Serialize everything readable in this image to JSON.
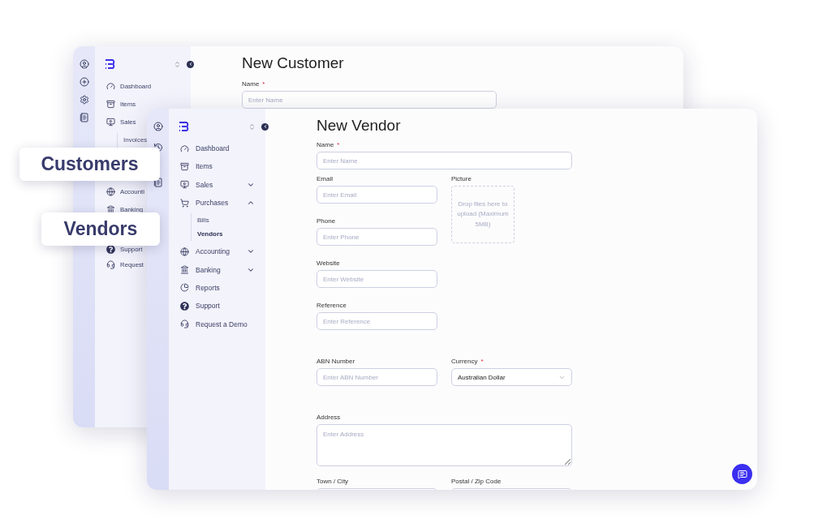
{
  "back_window": {
    "title": "New Customer",
    "nav": [
      {
        "label": "Dashboard"
      },
      {
        "label": "Items"
      },
      {
        "label": "Sales",
        "children": [
          {
            "label": "Invoices",
            "selected": false
          }
        ]
      },
      {
        "label": "Accounti"
      },
      {
        "label": "Banking"
      },
      {
        "label": "Support"
      },
      {
        "label": "Request"
      }
    ],
    "name_field": {
      "label": "Name",
      "required_mark": "*",
      "placeholder": "Enter Name"
    }
  },
  "front_window": {
    "title": "New Vendor",
    "nav": [
      {
        "label": "Dashboard"
      },
      {
        "label": "Items"
      },
      {
        "label": "Sales",
        "expanded": false
      },
      {
        "label": "Purchases",
        "expanded": true,
        "children": [
          {
            "label": "Bills",
            "selected": false
          },
          {
            "label": "Vendors",
            "selected": true
          }
        ]
      },
      {
        "label": "Accounting",
        "expanded": false
      },
      {
        "label": "Banking",
        "expanded": false
      },
      {
        "label": "Reports"
      },
      {
        "label": "Support"
      },
      {
        "label": "Request a Demo"
      }
    ],
    "name_field": {
      "label": "Name",
      "required_mark": "*",
      "placeholder": "Enter Name"
    },
    "contact_fields": [
      {
        "label": "Email",
        "placeholder": "Enter Email"
      },
      {
        "label": "Phone",
        "placeholder": "Enter Phone"
      },
      {
        "label": "Website",
        "placeholder": "Enter Website"
      },
      {
        "label": "Reference",
        "placeholder": "Enter Reference"
      }
    ],
    "picture": {
      "label": "Picture",
      "hint": "Drop files here to upload (Maximum 5MB)"
    },
    "tax_row": [
      {
        "kind": "text",
        "label": "ABN Number",
        "placeholder": "Enter ABN Number"
      },
      {
        "kind": "select",
        "label": "Currency",
        "required_mark": "*",
        "value": "Australian Dollar"
      }
    ],
    "address": {
      "label": "Address",
      "placeholder": "Enter Address"
    },
    "location_row": [
      {
        "kind": "text",
        "label": "Town / City"
      },
      {
        "kind": "text",
        "label": "Postal / Zip Code"
      }
    ]
  },
  "callouts": [
    "Customers",
    "Vendors"
  ]
}
